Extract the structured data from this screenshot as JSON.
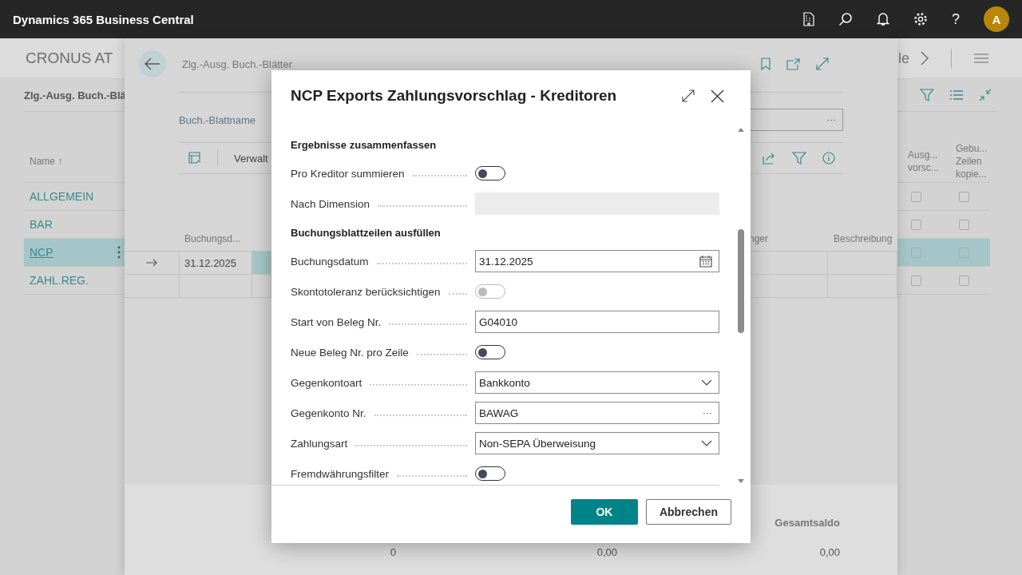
{
  "app_bar": {
    "title": "Dynamics 365 Business Central",
    "help": "?",
    "avatar": "A"
  },
  "list_page": {
    "company": "CRONUS AT",
    "title": "Zlg.-Ausg. Buch.-Blä",
    "nav_text": "le",
    "name_column": "Name ↑",
    "flag_columns": [
      "Ausg... vorsc...",
      "Gebu... Zeilen kopie..."
    ],
    "rows": [
      {
        "name": "ALLGEMEIN",
        "selected": false,
        "flags": [
          false,
          false
        ]
      },
      {
        "name": "BAR",
        "selected": false,
        "flags": [
          false,
          false
        ]
      },
      {
        "name": "NCP",
        "selected": true,
        "flags": [
          false,
          false
        ]
      },
      {
        "name": "ZAHL.REG.",
        "selected": false,
        "flags": [
          false,
          false
        ]
      }
    ]
  },
  "journal": {
    "breadcrumb": "Zlg.-Ausg. Buch.-Blätter",
    "field_label": "Buch.-Blattname",
    "lookup": "···",
    "action": "Verwalt",
    "columns": [
      "Buchungsd...",
      "nger",
      "Beschreibung"
    ],
    "row_date": "31.12.2025",
    "total_label": "Gesamtsaldo",
    "totals": [
      "0",
      "0,00",
      "0,00"
    ]
  },
  "dialog": {
    "title": "NCP Exports Zahlungsvorschlag - Kreditoren",
    "fields": [
      {
        "kind": "heading",
        "label": "Ergebnisse zusammenfassen"
      },
      {
        "kind": "toggle",
        "label": "Pro Kreditor summieren",
        "on": false,
        "disabled": false
      },
      {
        "kind": "readonly",
        "label": "Nach Dimension"
      },
      {
        "kind": "heading",
        "label": "Buchungsblattzeilen ausfüllen"
      },
      {
        "kind": "date",
        "label": "Buchungsdatum",
        "value": "31.12.2025"
      },
      {
        "kind": "toggle",
        "label": "Skontotoleranz berücksichtigen",
        "on": false,
        "disabled": true
      },
      {
        "kind": "text",
        "label": "Start von Beleg Nr.",
        "value": "G04010"
      },
      {
        "kind": "toggle",
        "label": "Neue Beleg Nr. pro Zeile",
        "on": false,
        "disabled": false
      },
      {
        "kind": "select",
        "label": "Gegenkontoart",
        "value": "Bankkonto"
      },
      {
        "kind": "lookup",
        "label": "Gegenkonto Nr.",
        "value": "BAWAG",
        "lookup": "···"
      },
      {
        "kind": "select",
        "label": "Zahlungsart",
        "value": "Non-SEPA Überweisung"
      },
      {
        "kind": "toggle",
        "label": "Fremdwährungsfilter",
        "on": false,
        "disabled": false
      }
    ],
    "buttons": [
      {
        "label": "OK",
        "primary": true
      },
      {
        "label": "Abbrechen",
        "primary": false
      }
    ]
  }
}
